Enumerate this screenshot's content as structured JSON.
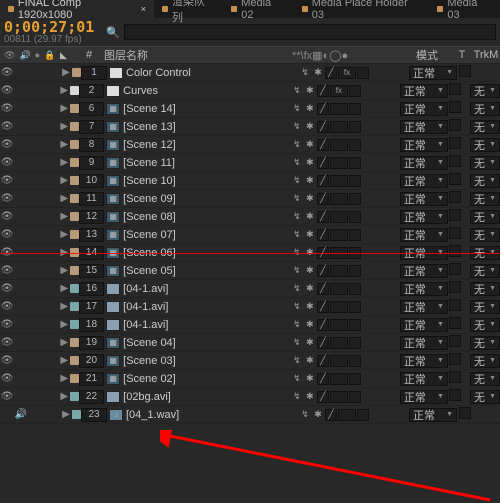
{
  "tabs": [
    {
      "label": "FINAL Comp 1920x1080",
      "active": true
    },
    {
      "label": "渲染队列",
      "active": false
    },
    {
      "label": "Media 02",
      "active": false
    },
    {
      "label": "Media Place Holder 03",
      "active": false
    },
    {
      "label": "Media 03",
      "active": false
    }
  ],
  "timecode": "0;00;27;01",
  "frameinfo": "00811 (29.97 fps)",
  "search": {
    "placeholder": ""
  },
  "headers": {
    "hash": "#",
    "layer_name": "图层名称",
    "switches": "**\\fx▦◐◯●",
    "mode": "模式",
    "t": "T",
    "trkmat": "TrkM"
  },
  "mode_label": "正常",
  "trk_label": "无",
  "color": {
    "tan": "#b89a7a",
    "teal": "#7aa8a8",
    "white": "#d8d8d8"
  },
  "layers": [
    {
      "n": 1,
      "name": "Color Control",
      "thumb": "white",
      "label": "tan",
      "fx": "fx",
      "eye": true,
      "spk": false,
      "trk": false,
      "hl": false
    },
    {
      "n": 2,
      "name": "Curves",
      "thumb": "white",
      "label": "white",
      "fx": "fx",
      "eye": true,
      "spk": false,
      "trk": true,
      "hl": false
    },
    {
      "n": 6,
      "name": "[Scene 14]",
      "thumb": "comp",
      "label": "tan",
      "fx": "",
      "eye": true,
      "spk": false,
      "trk": true,
      "hl": false
    },
    {
      "n": 7,
      "name": "[Scene 13]",
      "thumb": "comp",
      "label": "tan",
      "fx": "",
      "eye": true,
      "spk": false,
      "trk": true,
      "hl": false
    },
    {
      "n": 8,
      "name": "[Scene 12]",
      "thumb": "comp",
      "label": "tan",
      "fx": "",
      "eye": true,
      "spk": false,
      "trk": true,
      "hl": false
    },
    {
      "n": 9,
      "name": "[Scene 11]",
      "thumb": "comp",
      "label": "tan",
      "fx": "",
      "eye": true,
      "spk": false,
      "trk": true,
      "hl": false
    },
    {
      "n": 10,
      "name": "[Scene 10]",
      "thumb": "comp",
      "label": "tan",
      "fx": "",
      "eye": true,
      "spk": false,
      "trk": true,
      "hl": false
    },
    {
      "n": 11,
      "name": "[Scene 09]",
      "thumb": "comp",
      "label": "tan",
      "fx": "",
      "eye": true,
      "spk": false,
      "trk": true,
      "hl": false
    },
    {
      "n": 12,
      "name": "[Scene 08]",
      "thumb": "comp",
      "label": "tan",
      "fx": "",
      "eye": true,
      "spk": false,
      "trk": true,
      "hl": false
    },
    {
      "n": 13,
      "name": "[Scene 07]",
      "thumb": "comp",
      "label": "tan",
      "fx": "",
      "eye": true,
      "spk": false,
      "trk": true,
      "hl": false
    },
    {
      "n": 14,
      "name": "[Scene 06]",
      "thumb": "comp",
      "label": "tan",
      "fx": "",
      "eye": true,
      "spk": false,
      "trk": true,
      "hl": true
    },
    {
      "n": 15,
      "name": "[Scene 05]",
      "thumb": "comp",
      "label": "tan",
      "fx": "",
      "eye": true,
      "spk": false,
      "trk": true,
      "hl": false
    },
    {
      "n": 16,
      "name": "[04-1.avi]",
      "thumb": "vid",
      "label": "teal",
      "fx": "",
      "eye": true,
      "spk": false,
      "trk": true,
      "hl": false
    },
    {
      "n": 17,
      "name": "[04-1.avi]",
      "thumb": "vid",
      "label": "teal",
      "fx": "",
      "eye": true,
      "spk": false,
      "trk": true,
      "hl": false
    },
    {
      "n": 18,
      "name": "[04-1.avi]",
      "thumb": "vid",
      "label": "teal",
      "fx": "",
      "eye": true,
      "spk": false,
      "trk": true,
      "hl": false
    },
    {
      "n": 19,
      "name": "[Scene 04]",
      "thumb": "comp",
      "label": "tan",
      "fx": "",
      "eye": true,
      "spk": false,
      "trk": true,
      "hl": false
    },
    {
      "n": 20,
      "name": "[Scene 03]",
      "thumb": "comp",
      "label": "tan",
      "fx": "",
      "eye": true,
      "spk": false,
      "trk": true,
      "hl": false
    },
    {
      "n": 21,
      "name": "[Scene 02]",
      "thumb": "comp",
      "label": "tan",
      "fx": "",
      "eye": true,
      "spk": false,
      "trk": true,
      "hl": false
    },
    {
      "n": 22,
      "name": "[02bg.avi]",
      "thumb": "vid",
      "label": "teal",
      "fx": "",
      "eye": true,
      "spk": false,
      "trk": true,
      "hl": false
    },
    {
      "n": 23,
      "name": "[04_1.wav]",
      "thumb": "aud",
      "label": "teal",
      "fx": "",
      "eye": false,
      "spk": true,
      "trk": false,
      "hl": false
    }
  ]
}
